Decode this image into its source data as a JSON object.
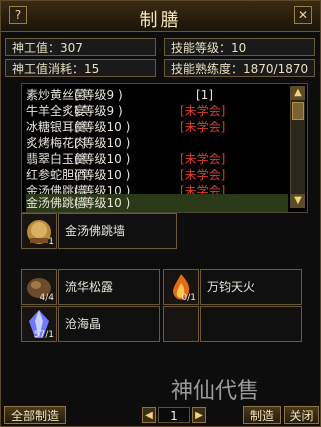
{
  "window": {
    "title": "制膳"
  },
  "header": {
    "help_label": "?",
    "close_label": "✕"
  },
  "stats": {
    "shengong": "神工值：307",
    "skill_level": "技能等级：10",
    "shengong_cost": "神工值消耗：15",
    "skill_prof": "技能熟练度：1870/1870"
  },
  "recipe_list": [
    {
      "name": "素炒黄丝菌",
      "level": "( 等级9 )",
      "status": "",
      "count": "[1]"
    },
    {
      "name": "牛羊全炙宴",
      "level": "( 等级9 )",
      "status": "[未学会]",
      "count": ""
    },
    {
      "name": "冰糖银耳羹",
      "level": "( 等级10 )",
      "status": "[未学会]",
      "count": ""
    },
    {
      "name": "炙烤梅花肉",
      "level": "( 等级10 )",
      "status": "",
      "count": ""
    },
    {
      "name": "翡翠白玉羹",
      "level": "( 等级10 )",
      "status": "[未学会]",
      "count": ""
    },
    {
      "name": "红参蛇胆酒",
      "level": "( 等级10 )",
      "status": "[未学会]",
      "count": ""
    },
    {
      "name": "金汤佛跳墙",
      "level": "( 等级10 )",
      "status": "[未学会]",
      "count": ""
    },
    {
      "name": "金汤佛跳墙",
      "level": "( 等级10 )",
      "status": "",
      "count": ""
    }
  ],
  "selected_product": {
    "name": "金汤佛跳墙",
    "count": "1"
  },
  "materials": [
    {
      "name": "流华松露",
      "count": "4/4",
      "icon": "truffle-icon"
    },
    {
      "name": "万钧天火",
      "count": "0/1",
      "icon": "fire-icon"
    },
    {
      "name": "沧海晶",
      "count": "57/1",
      "icon": "crystal-icon"
    }
  ],
  "footer": {
    "make_all": "全部制造",
    "page": "1",
    "make": "制造",
    "close": "关闭",
    "prev": "◀",
    "next": "▶"
  },
  "scroll": {
    "up": "▲",
    "down": "▼"
  },
  "watermark": "神仙代售"
}
